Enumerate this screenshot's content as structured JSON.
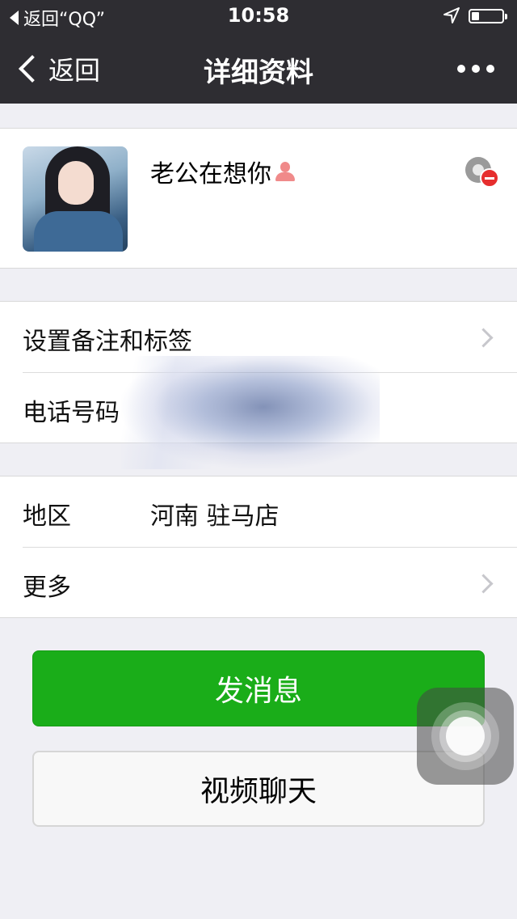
{
  "status_bar": {
    "back_app": "返回“QQ”",
    "time": "10:58",
    "location_icon": "location-arrow-icon",
    "battery_level": 0.25
  },
  "nav": {
    "back_label": "返回",
    "title": "详细资料",
    "more_icon": "more-dots-icon"
  },
  "profile": {
    "name": "老公在想你",
    "gender_icon": "female-icon",
    "blocked_icon": "blocked-moments-icon"
  },
  "rows": {
    "remark_label": "设置备注和标签",
    "phone_label": "电话号码",
    "region_label": "地区",
    "region_value": "河南 驻马店",
    "more_label": "更多"
  },
  "buttons": {
    "send_message": "发消息",
    "video_chat": "视频聊天"
  },
  "colors": {
    "nav_bg": "#2e2d32",
    "accent_green": "#1aad19",
    "page_bg": "#efeff4"
  }
}
